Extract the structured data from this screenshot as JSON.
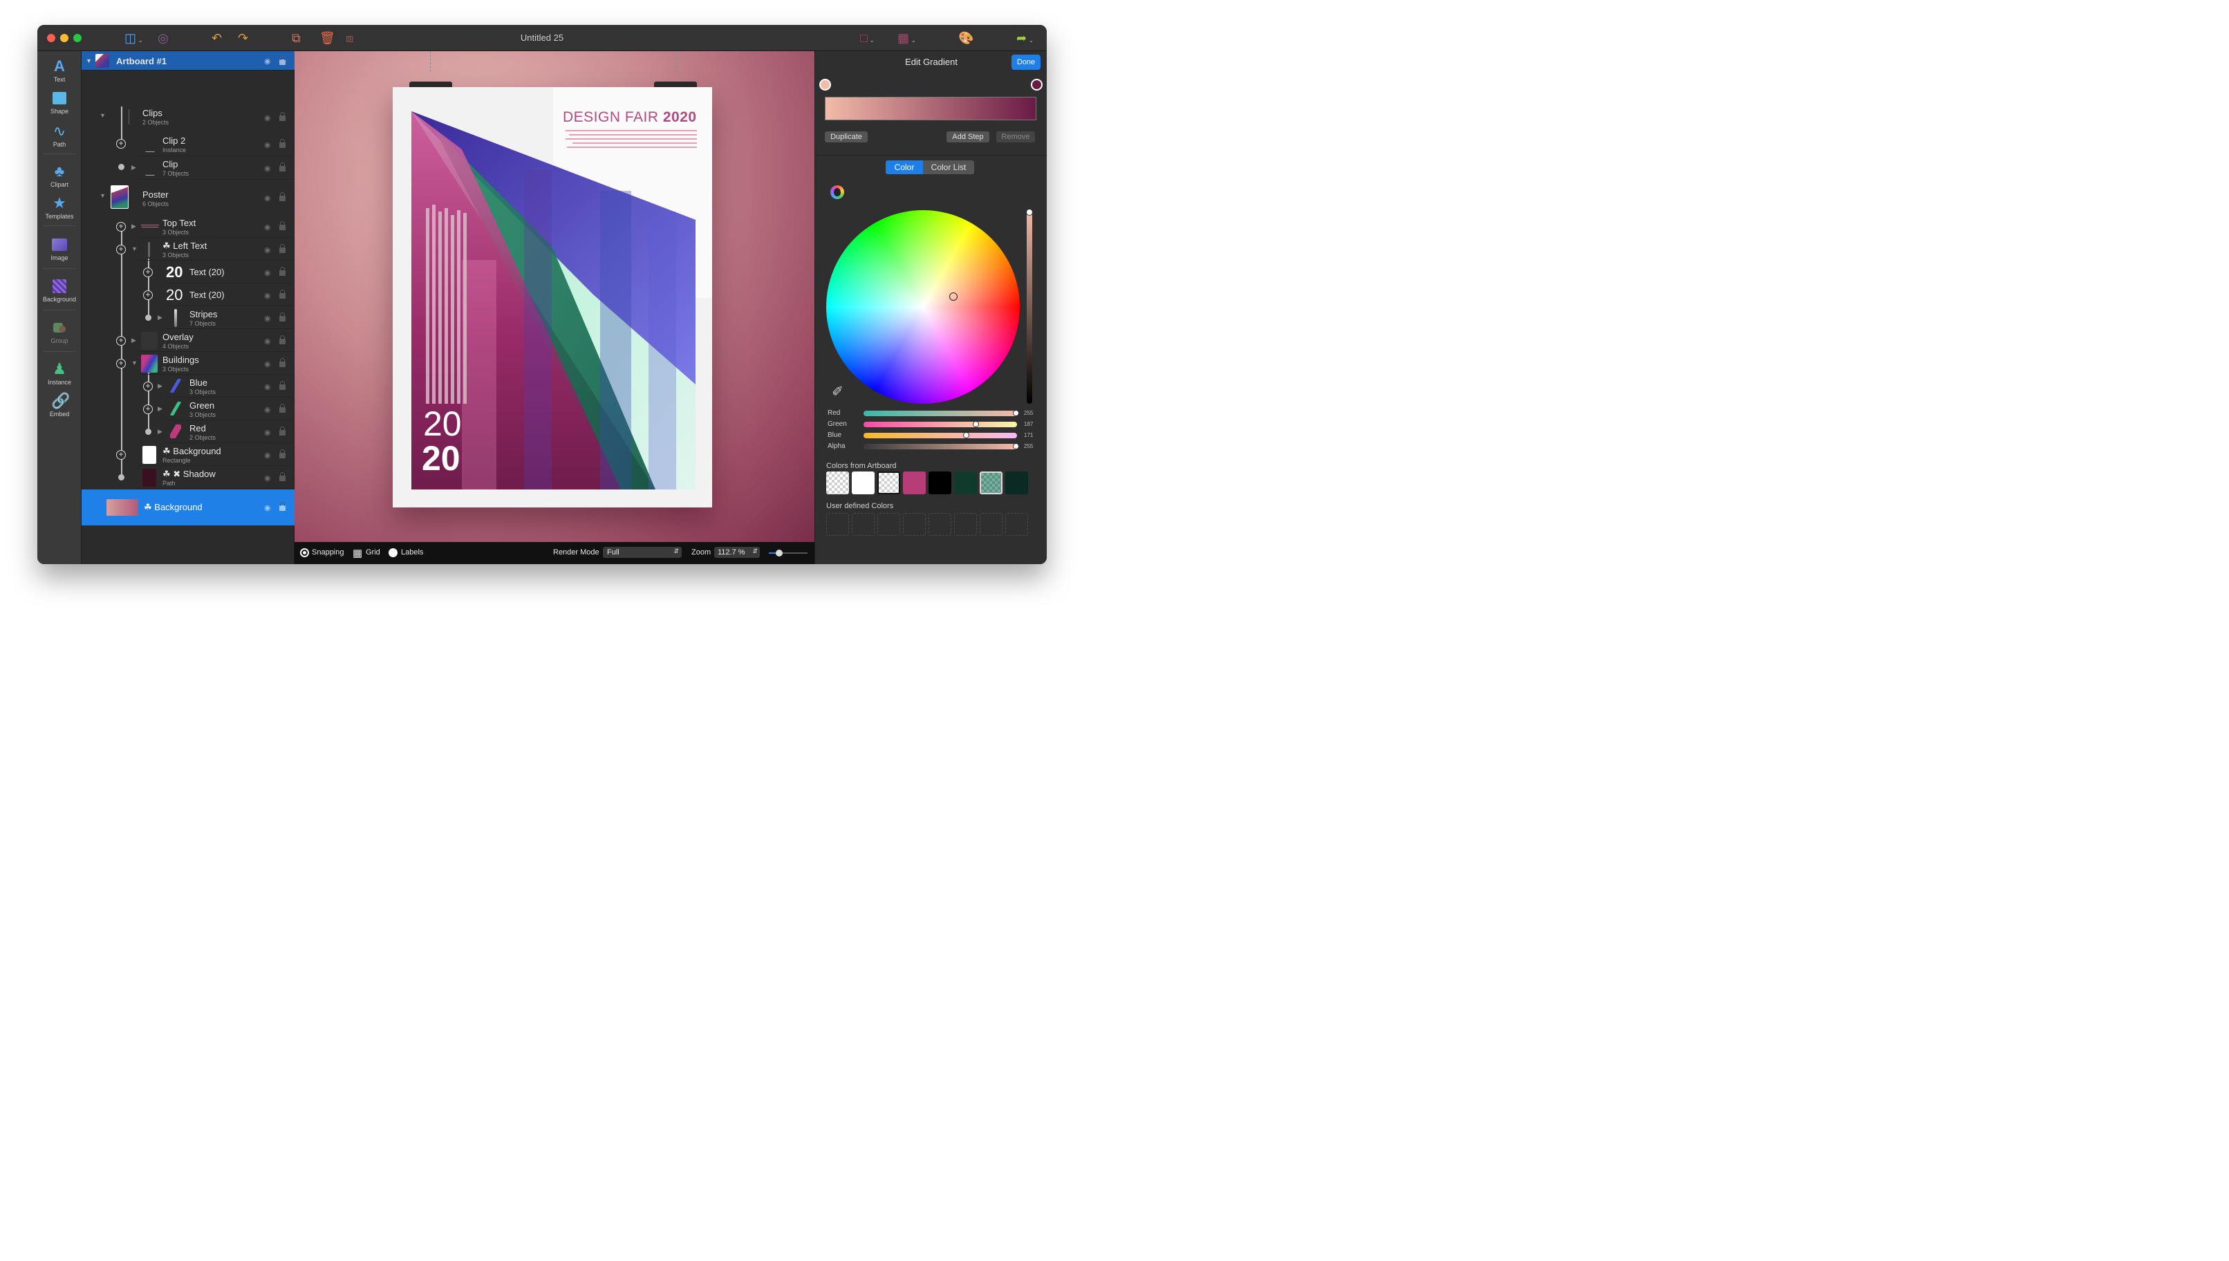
{
  "window": {
    "title": "Untitled 25"
  },
  "toolbox": {
    "tools": [
      {
        "label": "Text",
        "icon": "text-icon"
      },
      {
        "label": "Shape",
        "icon": "shape-icon"
      },
      {
        "label": "Path",
        "icon": "path-icon"
      },
      {
        "label": "Clipart",
        "icon": "clipart-icon"
      },
      {
        "label": "Templates",
        "icon": "templates-icon"
      },
      {
        "label": "Image",
        "icon": "image-icon"
      },
      {
        "label": "Background",
        "icon": "background-icon"
      },
      {
        "label": "Group",
        "icon": "group-icon"
      },
      {
        "label": "Instance",
        "icon": "instance-icon"
      },
      {
        "label": "Embed",
        "icon": "embed-icon"
      }
    ]
  },
  "layers": {
    "artboard": "Artboard #1",
    "items": [
      {
        "name": "Clips",
        "sub": "2 Objects"
      },
      {
        "name": "Clip 2",
        "sub": "Instance"
      },
      {
        "name": "Clip",
        "sub": "7 Objects"
      },
      {
        "name": "Poster",
        "sub": "6 Objects"
      },
      {
        "name": "Top Text",
        "sub": "3 Objects"
      },
      {
        "name": "Left Text",
        "sub": "3 Objects"
      },
      {
        "name": "Text (20)",
        "sub": "",
        "thumb_text": "20"
      },
      {
        "name": "Text (20)",
        "sub": "",
        "thumb_text": "20"
      },
      {
        "name": "Stripes",
        "sub": "7 Objects"
      },
      {
        "name": "Overlay",
        "sub": "4 Objects"
      },
      {
        "name": "Buildings",
        "sub": "3 Objects"
      },
      {
        "name": "Blue",
        "sub": "3 Objects"
      },
      {
        "name": "Green",
        "sub": "3 Objects"
      },
      {
        "name": "Red",
        "sub": "2 Objects"
      },
      {
        "name": "Background",
        "sub": "Rectangle"
      },
      {
        "name": "Shadow",
        "sub": "Path"
      }
    ],
    "selected": "Background"
  },
  "poster": {
    "headline_a": "DESIGN FAIR ",
    "headline_b": "2020",
    "big_top": "20",
    "big_bottom": "20"
  },
  "bottombar": {
    "snapping": "Snapping",
    "grid": "Grid",
    "labels": "Labels",
    "render_mode_label": "Render Mode",
    "render_mode_value": "Full",
    "zoom_label": "Zoom",
    "zoom_value": "112.7 %"
  },
  "inspector": {
    "title": "Edit Gradient",
    "done": "Done",
    "duplicate": "Duplicate",
    "add_step": "Add Step",
    "remove": "Remove",
    "tab_color": "Color",
    "tab_color_list": "Color List",
    "sliders": [
      {
        "label": "Red",
        "value": "255",
        "fraction": 0.996
      },
      {
        "label": "Green",
        "value": "187",
        "fraction": 0.733
      },
      {
        "label": "Blue",
        "value": "171",
        "fraction": 0.671
      },
      {
        "label": "Alpha",
        "value": "255",
        "fraction": 0.996
      }
    ],
    "colors_from_artboard_label": "Colors from Artboard",
    "user_defined_label": "User defined Colors",
    "artboard_colors": [
      "checker",
      "#ffffff",
      "checker",
      "#b73d78",
      "#000000",
      "#0f3a2c",
      "checker-green",
      "#0b2a22"
    ],
    "gradient_start": "#f3bba8",
    "gradient_end": "#6a1a45"
  }
}
